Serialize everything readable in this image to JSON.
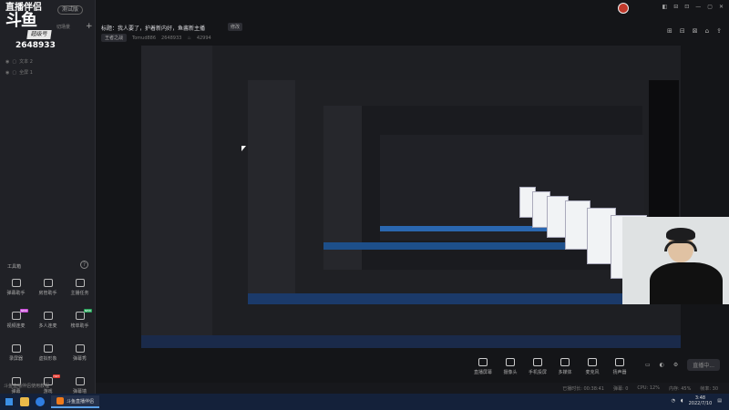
{
  "sidebar": {
    "logo_line1": "直播伴侣",
    "logo_line2": "斗鱼",
    "version_pill": "测试版",
    "badge": "超级号",
    "room_id": "2648933",
    "add_scene": "+",
    "scene_switch": "切场景",
    "rows": [
      {
        "label": "文本 2"
      },
      {
        "label": "全屏 1"
      }
    ],
    "tools_header": "工具箱",
    "tools_help": "?",
    "tools": [
      {
        "label": "弹幕助手",
        "tag": ""
      },
      {
        "label": "房管助手",
        "tag": ""
      },
      {
        "label": "主播任务",
        "tag": ""
      },
      {
        "label": "视频连麦",
        "tag": "NEW"
      },
      {
        "label": "多人连麦",
        "tag": ""
      },
      {
        "label": "榜单助手",
        "tag": "NEW"
      },
      {
        "label": "录屏器",
        "tag": ""
      },
      {
        "label": "虚拟形象",
        "tag": ""
      },
      {
        "label": "弹幕秀",
        "tag": ""
      },
      {
        "label": "弹幕",
        "tag": ""
      },
      {
        "label": "游戏",
        "tag": "HOT"
      },
      {
        "label": "弹幕墙",
        "tag": ""
      }
    ]
  },
  "header": {
    "title": "标题：我人要了，护着新内好，鱼酱新主播",
    "edit_label": "修改",
    "category": "王者之战",
    "user": "Tomud886",
    "room_no": "2648933",
    "viewers": "42994",
    "window_controls": [
      "◧",
      "⊟",
      "⊡",
      "—",
      "▢",
      "✕"
    ],
    "right_icons": [
      "⊞",
      "⊟",
      "⊠",
      "⌂",
      "⇪"
    ]
  },
  "bottom_bar": {
    "buttons": [
      {
        "label": "直播屏幕"
      },
      {
        "label": "摄像头"
      },
      {
        "label": "手机投屏"
      },
      {
        "label": "多媒体"
      },
      {
        "label": "麦克风"
      },
      {
        "label": "扬声器"
      }
    ],
    "right_icons": [
      "▭",
      "◐",
      "⚙"
    ],
    "start_label": "直播中..."
  },
  "statusbar": {
    "left": "斗鱼直播伴侣使用教程",
    "items": [
      "已播时长: 00:38:41",
      "弹幕: 0",
      "CPU: 12%",
      "内存: 45%",
      "帧率: 30"
    ]
  },
  "taskbar": {
    "app_label": "斗鱼直播伴侣",
    "time": "3:48",
    "date": "2022/7/10"
  }
}
